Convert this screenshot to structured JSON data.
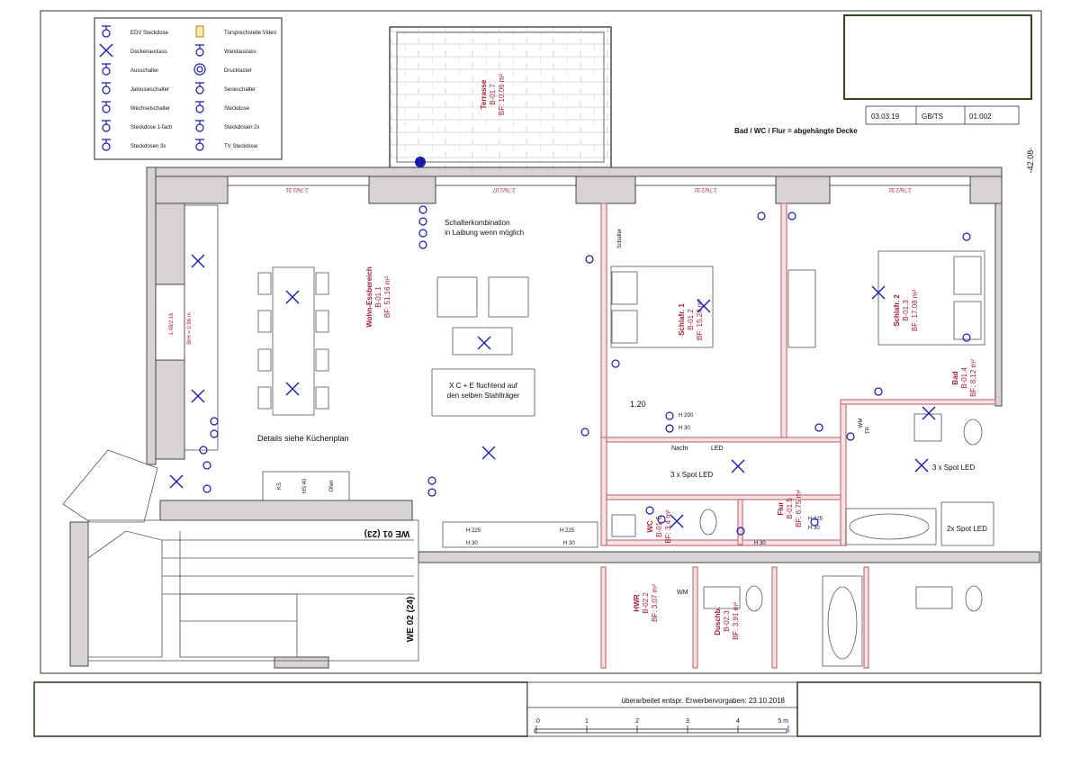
{
  "legend": {
    "items": [
      {
        "label": "EDV Steckdose",
        "icon": "edv-socket-icon"
      },
      {
        "label": "Türsprechstelle Video",
        "icon": "video-intercom-icon"
      },
      {
        "label": "Deckenauslass",
        "icon": "ceiling-outlet-icon"
      },
      {
        "label": "Wandauslass",
        "icon": "wall-outlet-icon"
      },
      {
        "label": "Ausschalter",
        "icon": "off-switch-icon"
      },
      {
        "label": "Drucktaster",
        "icon": "push-button-icon"
      },
      {
        "label": "Jalousieschalter",
        "icon": "blind-switch-icon"
      },
      {
        "label": "Serieschalter",
        "icon": "series-switch-icon"
      },
      {
        "label": "Wechselschalter",
        "icon": "two-way-switch-icon"
      },
      {
        "label": "Steckdose",
        "icon": "socket-icon"
      },
      {
        "label": "Steckdose 1-fach",
        "icon": "single-socket-icon"
      },
      {
        "label": "Steckdosen 2x",
        "icon": "double-socket-icon"
      },
      {
        "label": "Steckdosen 3x",
        "icon": "triple-socket-icon"
      },
      {
        "label": "TV Steckdose",
        "icon": "tv-socket-icon"
      }
    ]
  },
  "title_block": {
    "date": "03.03.19",
    "author": "GB/TS",
    "sheet": "01:002",
    "ceiling_note": "Bad / WC / Flur = abgehängte Decke",
    "elevation": "-42.08-"
  },
  "rooms": {
    "terrace": {
      "name": "Terrasse",
      "code": "B-01.7",
      "area": "BF: 10.06 m²"
    },
    "living": {
      "name": "Wohn-Essbereich",
      "code": "B-01.1",
      "area": "BF: 51.16 m²"
    },
    "bed1": {
      "name": "Schlafr. 1",
      "code": "B-01.2",
      "area": "BF: 15.24 m²"
    },
    "bed2": {
      "name": "Schlafr. 2",
      "code": "B-01.3",
      "area": "BF: 17.08 m²"
    },
    "bath": {
      "name": "Bad",
      "code": "B-01.4",
      "area": "BF: 8.12 m²"
    },
    "hall": {
      "name": "Flur",
      "code": "B-01.5",
      "area": "BF: 6.75 m²"
    },
    "wc": {
      "name": "WC",
      "code": "B-01.6",
      "area": "BF: 3.4 m²"
    },
    "hwr": {
      "name": "HWR",
      "code": "B-02.2",
      "area": "BF: 3.07 m²"
    },
    "shower": {
      "name": "Duschb.",
      "code": "B-02.3",
      "area": "BF: 3.91 m²"
    }
  },
  "annotations": {
    "switch_combo_1": "Schalterkombination",
    "switch_combo_2": "in Laibung wenn möglich",
    "beam_1": "X C + E fluchtend auf",
    "beam_2": "den selben Stahlträger",
    "kitchen": "Details siehe Küchenplan",
    "spot_hall": "3 x Spot LED",
    "spot_bath": "3 x Spot LED",
    "spot_tub": "2x Spot LED",
    "dim_120": "1.20",
    "night": "Nacht",
    "led": "LED",
    "we01": "WE 01 (23)",
    "we02": "WE 02 (24)",
    "ks": "KS",
    "hs": "HS 40",
    "ofen": "Ofen",
    "wm": "WM",
    "tr": "TR",
    "h225": "H 225",
    "h30": "H 30",
    "h200": "H 200",
    "window_1": "2.76/2.31",
    "window_2": "2.76/2.07",
    "window_3": "2.76/2.32",
    "window_4": "2.76/2.32",
    "window_side": "1.48/2.16",
    "brh": "BrH = 0.96 m",
    "schalter": "Schalter"
  },
  "footer": {
    "revision": "überarbeitet entspr. Erwerbervorgaben: 23.10.2018",
    "scale_ticks": [
      "0",
      "1",
      "2",
      "3",
      "4",
      "5 m"
    ]
  }
}
